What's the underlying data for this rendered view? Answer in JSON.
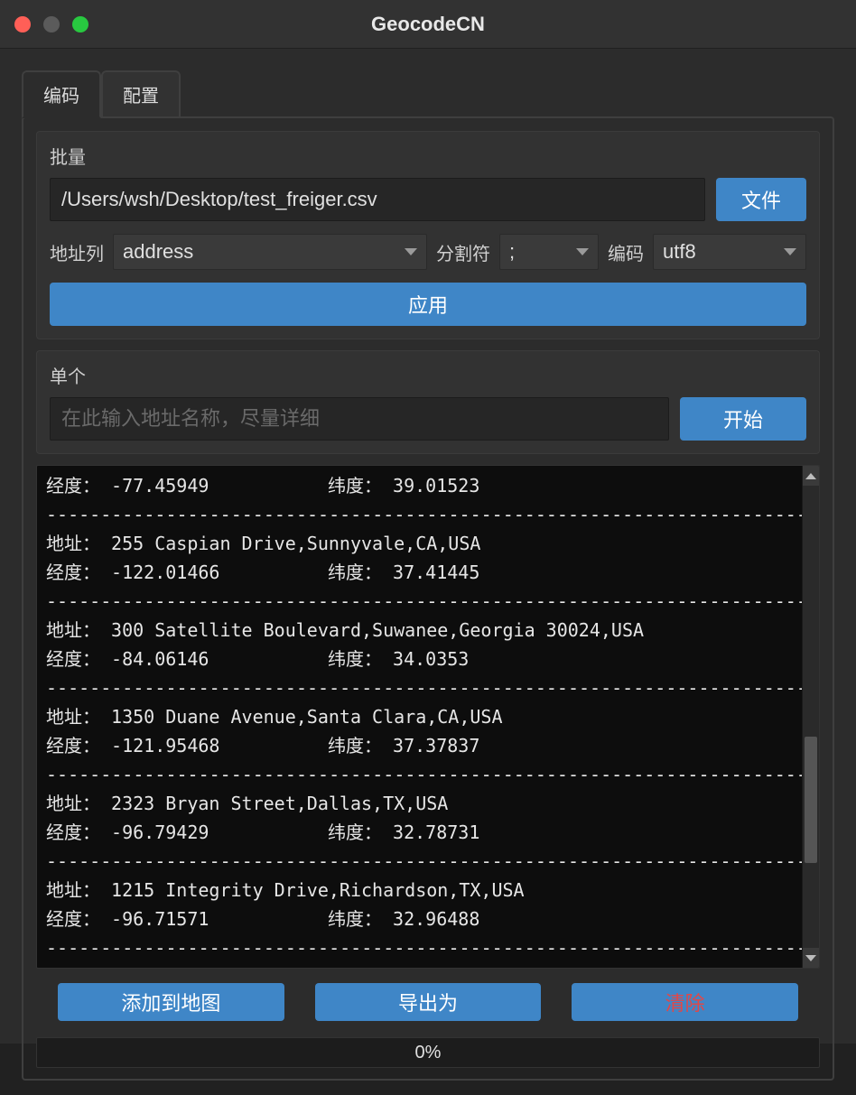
{
  "window_title": "GeocodeCN",
  "tabs": {
    "encode": "编码",
    "config": "配置"
  },
  "batch": {
    "title": "批量",
    "file_path": "/Users/wsh/Desktop/test_freiger.csv",
    "file_btn": "文件",
    "addr_col_label": "地址列",
    "addr_col_value": "address",
    "sep_label": "分割符",
    "sep_value": ";",
    "enc_label": "编码",
    "enc_value": "utf8",
    "apply_btn": "应用"
  },
  "single": {
    "title": "单个",
    "placeholder": "在此输入地址名称，尽量详细",
    "start_btn": "开始"
  },
  "log": {
    "addr_label": "地址：",
    "lon_label": "经度：",
    "lat_label": "纬度：",
    "separator": "---------------------------------------------------------------------------------",
    "first_partial": {
      "lon": "-77.45949",
      "lat": "39.01523"
    },
    "entries": [
      {
        "addr": "255 Caspian Drive,Sunnyvale,CA,USA",
        "lon": "-122.01466",
        "lat": "37.41445"
      },
      {
        "addr": "300 Satellite Boulevard,Suwanee,Georgia 30024,USA",
        "lon": "-84.06146",
        "lat": "34.0353"
      },
      {
        "addr": "1350 Duane Avenue,Santa Clara,CA,USA",
        "lon": "-121.95468",
        "lat": "37.37837"
      },
      {
        "addr": "2323 Bryan Street,Dallas,TX,USA",
        "lon": "-96.79429",
        "lat": "32.78731"
      },
      {
        "addr": "1215 Integrity Drive,Richardson,TX,USA",
        "lon": "-96.71571",
        "lat": "32.96488"
      }
    ]
  },
  "actions": {
    "add_to_map": "添加到地图",
    "export_as": "导出为",
    "clear": "清除"
  },
  "progress_text": "0%"
}
